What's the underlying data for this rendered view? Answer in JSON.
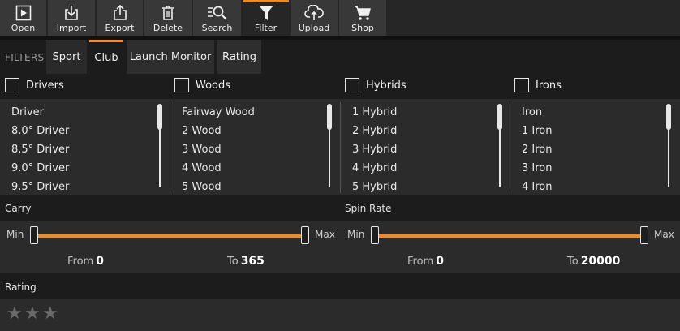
{
  "toolbar": {
    "items": [
      {
        "label": "Open",
        "icon": "play-icon"
      },
      {
        "label": "Import",
        "icon": "import-icon"
      },
      {
        "label": "Export",
        "icon": "export-icon"
      },
      {
        "label": "Delete",
        "icon": "trash-icon"
      },
      {
        "label": "Search",
        "icon": "search-icon"
      },
      {
        "label": "Filter",
        "icon": "filter-icon",
        "active": true
      },
      {
        "label": "Upload",
        "icon": "cloud-upload-icon"
      },
      {
        "label": "Shop",
        "icon": "cart-icon"
      }
    ]
  },
  "filters": {
    "label": "FILTERS",
    "tabs": [
      {
        "label": "Sport"
      },
      {
        "label": "Club",
        "active": true
      },
      {
        "label": "Launch Monitor"
      },
      {
        "label": "Rating"
      }
    ]
  },
  "clubs": {
    "categories": [
      {
        "label": "Drivers",
        "checked": false,
        "items": [
          "Driver",
          "8.0° Driver",
          "8.5° Driver",
          "9.0° Driver",
          "9.5° Driver"
        ]
      },
      {
        "label": "Woods",
        "checked": false,
        "items": [
          "Fairway Wood",
          "2 Wood",
          "3 Wood",
          "4 Wood",
          "5 Wood"
        ]
      },
      {
        "label": "Hybrids",
        "checked": false,
        "items": [
          "1 Hybrid",
          "2 Hybrid",
          "3 Hybrid",
          "4 Hybrid",
          "5 Hybrid"
        ]
      },
      {
        "label": "Irons",
        "checked": false,
        "items": [
          "Iron",
          "1 Iron",
          "2 Iron",
          "3 Iron",
          "4 Iron"
        ]
      }
    ]
  },
  "carry": {
    "title": "Carry",
    "min_label": "Min",
    "max_label": "Max",
    "from_label": "From",
    "from_value": "0",
    "to_label": "To",
    "to_value": "365"
  },
  "spin": {
    "title": "Spin Rate",
    "min_label": "Min",
    "max_label": "Max",
    "from_label": "From",
    "from_value": "0",
    "to_label": "To",
    "to_value": "20000"
  },
  "rating": {
    "title": "Rating",
    "stars_total": 3,
    "stars_selected": 0
  },
  "colors": {
    "accent": "#f3891f",
    "background": "#1b1b1b",
    "panel": "#2b2b2b"
  }
}
